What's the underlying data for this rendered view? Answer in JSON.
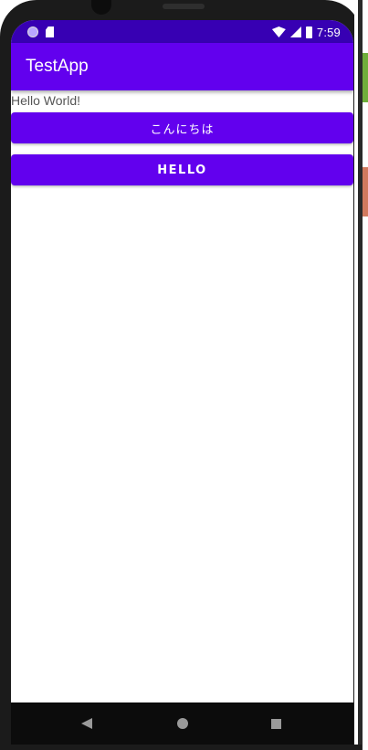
{
  "status_bar": {
    "time": "7:59",
    "icons": [
      "notification-dot-icon",
      "sd-card-icon",
      "wifi-icon",
      "signal-icon",
      "battery-icon"
    ]
  },
  "app_bar": {
    "title": "TestApp"
  },
  "content": {
    "hello_text": "Hello World!",
    "button_japanese_label": "こんにちは",
    "button_hello_label": "HELLO"
  },
  "nav_bar": {
    "icons": [
      "back-icon",
      "home-icon",
      "recent-apps-icon"
    ]
  },
  "colors": {
    "status_bar": "#3700b3",
    "primary": "#6200ee",
    "button_text": "#ffffff"
  }
}
